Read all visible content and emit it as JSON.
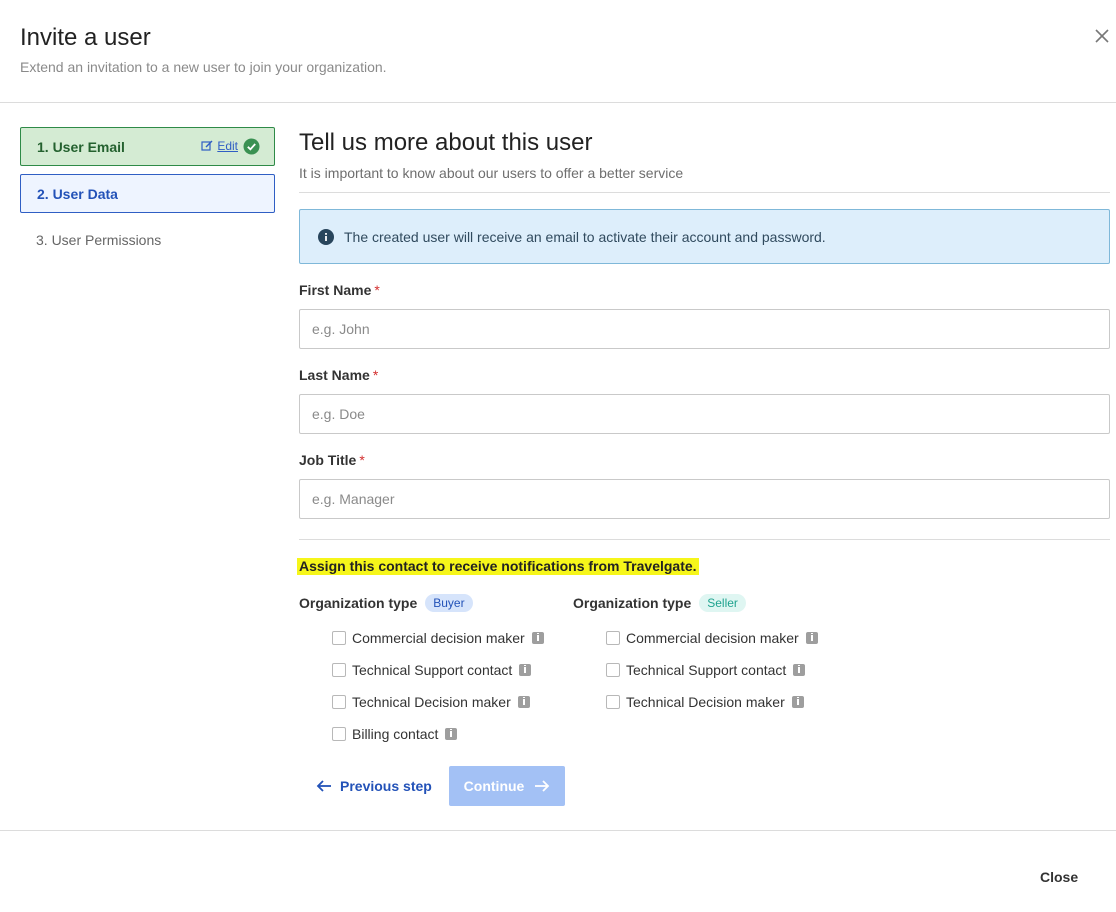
{
  "dialog": {
    "title": "Invite a user",
    "subtitle": "Extend an invitation to a new user to join your organization.",
    "close_icon": "close-icon"
  },
  "steps": [
    {
      "label": "1. User Email",
      "state": "done",
      "edit_label": "Edit"
    },
    {
      "label": "2. User Data",
      "state": "active"
    },
    {
      "label": "3. User Permissions",
      "state": "pending"
    }
  ],
  "main": {
    "title": "Tell us more about this user",
    "subtitle": "It is important to know about our users to offer a better service",
    "info_text": "The created user will receive an email to activate their account and password."
  },
  "form": {
    "first_name": {
      "label": "First Name",
      "required": "*",
      "placeholder": "e.g. John",
      "value": ""
    },
    "last_name": {
      "label": "Last Name",
      "required": "*",
      "placeholder": "e.g. Doe",
      "value": ""
    },
    "job_title": {
      "label": "Job Title",
      "required": "*",
      "placeholder": "e.g. Manager",
      "value": ""
    }
  },
  "notifications": {
    "heading": "Assign this contact to receive notifications from Travelgate.",
    "buyer": {
      "label": "Organization type",
      "badge": "Buyer",
      "options": [
        "Commercial decision maker",
        "Technical Support contact",
        "Technical Decision maker",
        "Billing contact"
      ]
    },
    "seller": {
      "label": "Organization type",
      "badge": "Seller",
      "options": [
        "Commercial decision maker",
        "Technical Support contact",
        "Technical Decision maker"
      ]
    }
  },
  "actions": {
    "previous_label": "Previous step",
    "continue_label": "Continue",
    "close_label": "Close"
  },
  "colors": {
    "accent": "#2352b8",
    "success": "#2e8a47",
    "highlight": "#f6f61a",
    "continue_disabled": "#a3c1f5"
  }
}
